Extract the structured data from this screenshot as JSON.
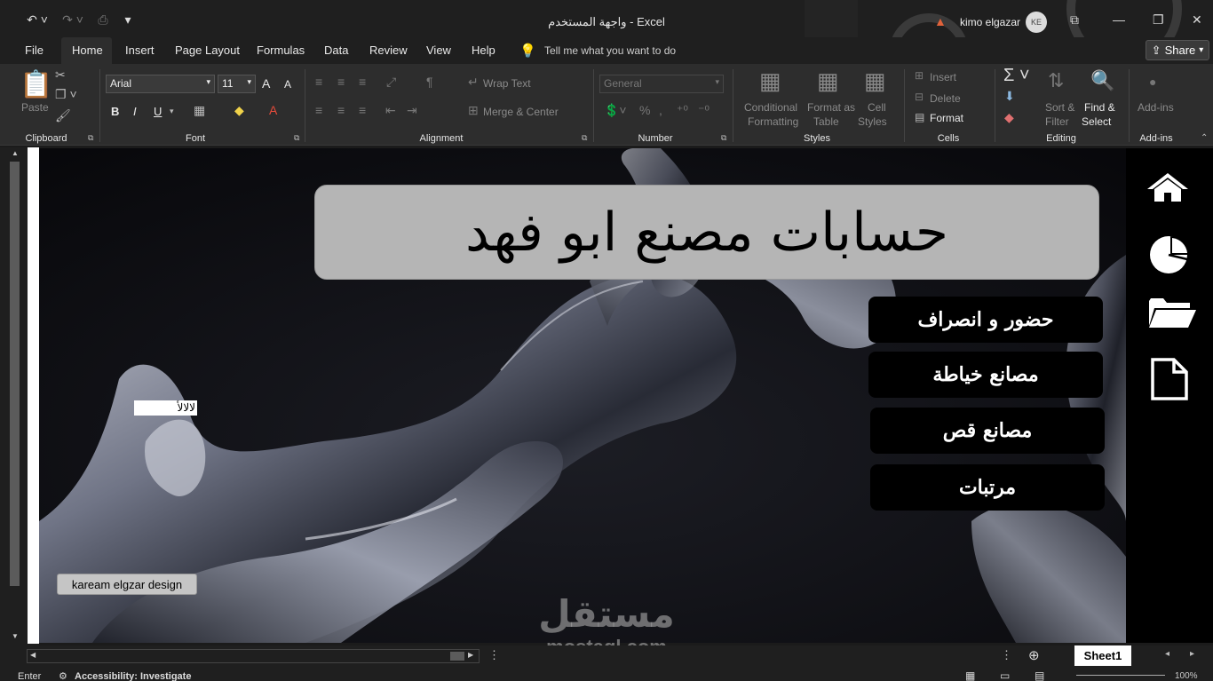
{
  "window": {
    "title": "واجهة المستخدم  -  Excel",
    "user": "kimo elgazar",
    "avatar_initials": "KE"
  },
  "tabs": [
    "File",
    "Home",
    "Insert",
    "Page Layout",
    "Formulas",
    "Data",
    "Review",
    "View",
    "Help"
  ],
  "active_tab": "Home",
  "tell_me": "Tell me what you want to do",
  "share": "Share",
  "ribbon": {
    "clipboard": {
      "paste": "Paste",
      "label": "Clipboard"
    },
    "font": {
      "name": "Arial",
      "size": "11",
      "bold": "B",
      "italic": "I",
      "underline": "U",
      "grow": "A",
      "shrink": "A",
      "label": "Font"
    },
    "alignment": {
      "wrap": "Wrap Text",
      "merge": "Merge & Center",
      "label": "Alignment"
    },
    "number": {
      "format": "General",
      "label": "Number"
    },
    "styles": {
      "conditional": "Conditional",
      "conditional2": "Formatting",
      "format_table": "Format as",
      "format_table2": "Table",
      "cell": "Cell",
      "cell2": "Styles",
      "label": "Styles"
    },
    "cells": {
      "insert": "Insert",
      "delete": "Delete",
      "format": "Format",
      "label": "Cells"
    },
    "editing": {
      "sort": "Sort &",
      "sort2": "Filter",
      "find": "Find &",
      "find2": "Select",
      "label": "Editing"
    },
    "addins": {
      "addins": "Add-ins",
      "label": "Add-ins"
    }
  },
  "sheet": {
    "title": "حسابات مصنع ابو فهد",
    "buttons": [
      "حضور و انصراف",
      "مصانع خياطة",
      "مصانع قص",
      "مرتبات"
    ],
    "cell_edit_value": "لالالأ",
    "design_button": "kaream elgzar design",
    "nav_icons": [
      "home-icon",
      "pie-chart-icon",
      "folder-open-icon",
      "document-icon"
    ]
  },
  "sheet_tab": "Sheet1",
  "status": {
    "mode": "Enter",
    "accessibility": "Accessibility: Investigate",
    "zoom": "100%"
  },
  "watermark": {
    "arabic": "مستقل",
    "latin": "mostaql.com"
  }
}
